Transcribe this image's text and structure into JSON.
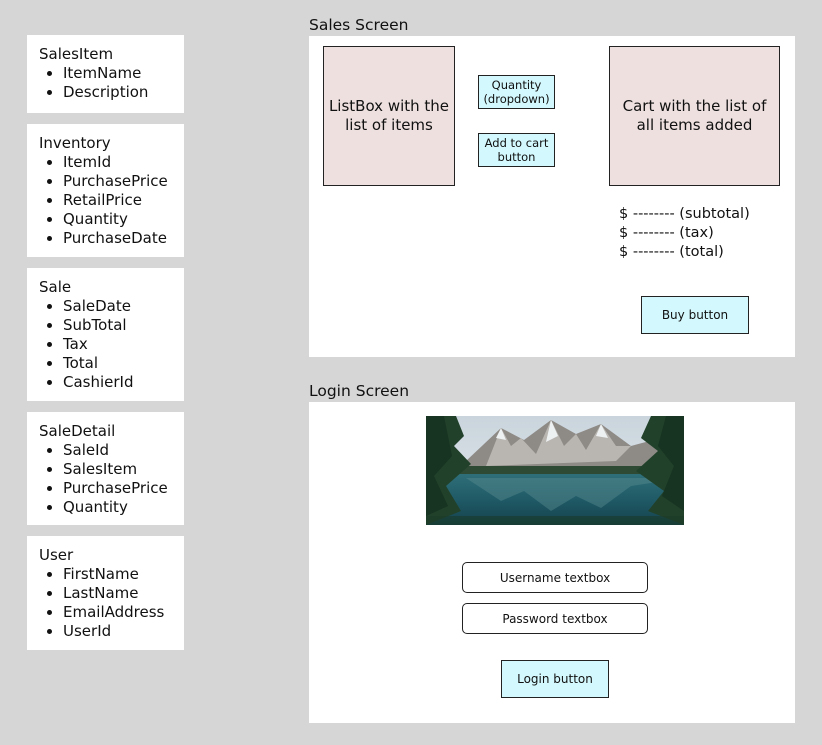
{
  "entities": [
    {
      "name": "SalesItem",
      "fields": [
        "ItemName",
        "Description"
      ]
    },
    {
      "name": "Inventory",
      "fields": [
        "ItemId",
        "PurchasePrice",
        "RetailPrice",
        "Quantity",
        "PurchaseDate"
      ]
    },
    {
      "name": "Sale",
      "fields": [
        "SaleDate",
        "SubTotal",
        "Tax",
        "Total",
        "CashierId"
      ]
    },
    {
      "name": "SaleDetail",
      "fields": [
        "SaleId",
        "SalesItem",
        "PurchasePrice",
        "Quantity"
      ]
    },
    {
      "name": "User",
      "fields": [
        "FirstName",
        "LastName",
        "EmailAddress",
        "UserId"
      ]
    }
  ],
  "sales_screen": {
    "title": "Sales Screen",
    "listbox_text": "ListBox with the list of items",
    "quantity_label": "Quantity (dropdown)",
    "add_to_cart_label": "Add to cart button",
    "cart_text": "Cart with the list of all items added",
    "subtotal_line": "$ -------- (subtotal)",
    "tax_line": "$ -------- (tax)",
    "total_line": "$ -------- (total)",
    "buy_label": "Buy button"
  },
  "login_screen": {
    "title": "Login Screen",
    "username_label": "Username textbox",
    "password_label": "Password textbox",
    "login_label": "Login button"
  },
  "colors": {
    "background": "#d6d6d6",
    "panel_fill": "#ede0df",
    "control_fill": "#d3f8fd",
    "frame_fill": "#ffffff"
  },
  "icons": {
    "landscape_image": "mountain-lake-photo"
  }
}
